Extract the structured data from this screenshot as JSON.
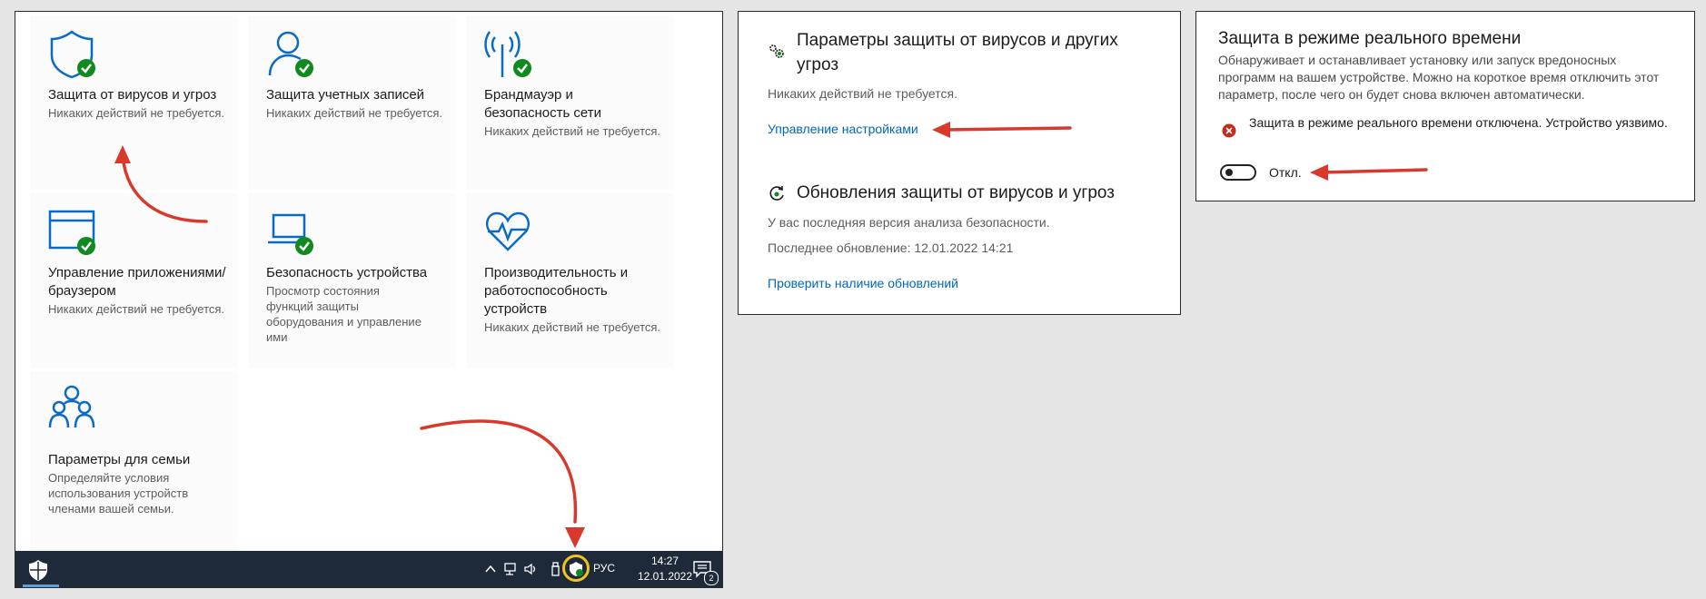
{
  "colors": {
    "accent_blue": "#0067b8",
    "icon_blue": "#0a6bc4",
    "ok_green": "#108a1f",
    "error_red": "#c42b1c",
    "annotation_red": "#d9382c",
    "highlight_yellow": "#f0c419",
    "taskbar": "#1e2a3a"
  },
  "security_home": {
    "tiles": [
      {
        "icon": "shield-check-icon",
        "title": "Защита от вирусов и угроз",
        "status": "Никаких действий не требуется."
      },
      {
        "icon": "account-check-icon",
        "title": "Защита учетных записей",
        "status": "Никаких действий не требуется."
      },
      {
        "icon": "wifi-antenna-check-icon",
        "title": "Брандмауэр и безопасность сети",
        "status": "Никаких действий не требуется."
      },
      {
        "icon": "app-browser-check-icon",
        "title": "Управление приложениями/браузером",
        "status": "Никаких действий не требуется."
      },
      {
        "icon": "laptop-check-icon",
        "title": "Безопасность устройства",
        "status": "Просмотр состояния функций защиты оборудования и управление ими"
      },
      {
        "icon": "heart-pulse-icon",
        "title": "Производительность и работоспособность устройств",
        "status": "Никаких действий не требуется."
      },
      {
        "icon": "family-icon",
        "title": "Параметры для семьи",
        "status": "Определяйте условия использования устройств членами вашей семьи."
      }
    ]
  },
  "taskbar": {
    "language": "РУС",
    "time": "14:27",
    "date": "12.01.2022",
    "notifications_count": "2"
  },
  "virus_settings": {
    "title": "Параметры защиты от вирусов и других угроз",
    "status": "Никаких действий не требуется.",
    "manage_link": "Управление настройками",
    "updates_title": "Обновления защиты от вирусов и угроз",
    "updates_status": "У вас последняя версия анализа безопасности.",
    "last_update": "Последнее обновление: 12.01.2022 14:21",
    "check_link": "Проверить наличие обновлений"
  },
  "realtime": {
    "title": "Защита в режиме реального времени",
    "description": "Обнаруживает и останавливает установку или запуск вредоносных программ на вашем устройстве. Можно на короткое время отключить этот параметр, после чего он будет снова включен автоматически.",
    "warning": "Защита в режиме реального времени отключена. Устройство уязвимо.",
    "toggle_label": "Откл.",
    "toggle_on": false
  }
}
